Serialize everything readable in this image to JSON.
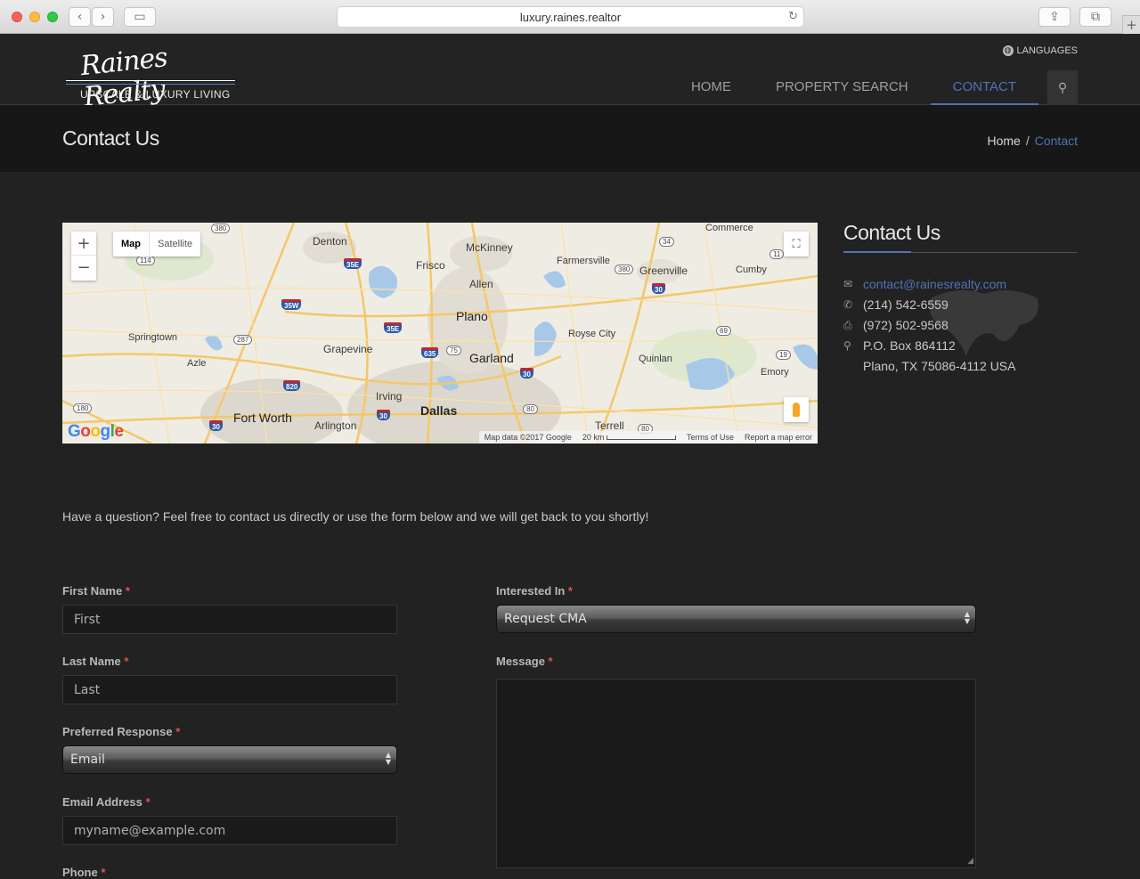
{
  "browser": {
    "url": "luxury.raines.realtor"
  },
  "header": {
    "logo_script": "Raines Realty",
    "logo_tagline": "UPSCALE & LUXURY LIVING",
    "languages_label": "LANGUAGES",
    "nav": [
      {
        "label": "HOME",
        "active": false
      },
      {
        "label": "PROPERTY SEARCH",
        "active": false
      },
      {
        "label": "CONTACT",
        "active": true
      }
    ]
  },
  "page": {
    "title": "Contact Us",
    "breadcrumb": {
      "home": "Home",
      "separator": "/",
      "current": "Contact"
    }
  },
  "map": {
    "type_map": "Map",
    "type_satellite": "Satellite",
    "zoom_in": "+",
    "zoom_out": "−",
    "google_logo": "Google",
    "footer_mapdata": "Map data ©2017 Google",
    "footer_scale": "20 km",
    "footer_terms": "Terms of Use",
    "footer_report": "Report a map error",
    "places": [
      "Denton",
      "McKinney",
      "Commerce",
      "Frisco",
      "Farmersville",
      "Greenville",
      "Cumby",
      "Allen",
      "Plano",
      "Springtown",
      "Royse City",
      "Grapevine",
      "Garland",
      "Azle",
      "Quinlan",
      "Emory",
      "Irving",
      "Fort Worth",
      "Dallas",
      "Arlington",
      "Terrell"
    ],
    "routes": [
      "380",
      "114",
      "35E",
      "35W",
      "287",
      "35E",
      "635",
      "75",
      "820",
      "30",
      "180",
      "30",
      "30",
      "80",
      "34",
      "380",
      "30",
      "69",
      "19",
      "11",
      "80"
    ]
  },
  "sidebar": {
    "title": "Contact Us",
    "email": "contact@rainesrealty.com",
    "phone": "(214) 542-6559",
    "fax": "(972) 502-9568",
    "address1": "P.O. Box 864112",
    "address2": "Plano, TX 75086-4112 USA"
  },
  "intro": "Have a question? Feel free to contact us directly or use the form below and we will get back to you shortly!",
  "form": {
    "required_mark": "*",
    "first_name": {
      "label": "First Name",
      "placeholder": "First"
    },
    "last_name": {
      "label": "Last Name",
      "placeholder": "Last"
    },
    "preferred_response": {
      "label": "Preferred Response",
      "value": "Email"
    },
    "email": {
      "label": "Email Address",
      "placeholder": "myname@example.com"
    },
    "phone": {
      "label": "Phone"
    },
    "interested_in": {
      "label": "Interested In",
      "value": "Request CMA"
    },
    "message": {
      "label": "Message"
    }
  },
  "colors": {
    "accent": "#4f72b8",
    "background": "#222222",
    "required": "#d9534f"
  }
}
